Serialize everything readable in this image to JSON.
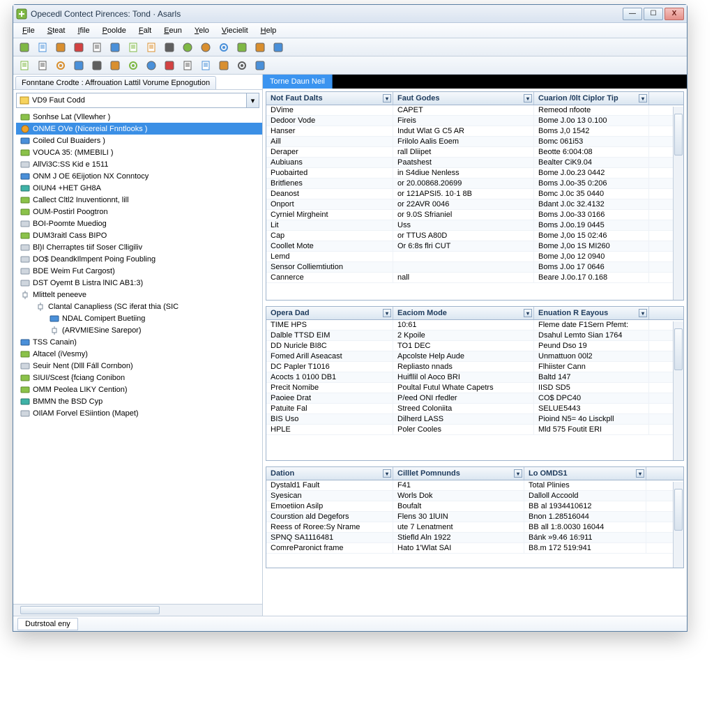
{
  "window": {
    "title": "Opecedl Contect Pirences: Tond · Asarls"
  },
  "menubar": [
    "File",
    "Steat",
    "Ifile",
    "Poolde",
    "Falt",
    "Eeun",
    "Yelo",
    "Viecielit",
    "Help"
  ],
  "lefttab": "Fonntane Crodte : Affrouation Lattil Vorume Epnogution",
  "combo": "VD9 Faut Codd",
  "tree": [
    {
      "label": "Sonhse Lat (Vllewher )",
      "ic": "green",
      "lv": 0
    },
    {
      "label": "ONME OVe (Nicereial Fnntlooks )",
      "ic": "orange",
      "lv": 0,
      "sel": true
    },
    {
      "label": "Coiled Cul Buaiders )",
      "ic": "blue",
      "lv": 0
    },
    {
      "label": "VOUCA 35: (MMEBILI )",
      "ic": "green",
      "lv": 0
    },
    {
      "label": "AllVi3C:SS Kid e 1511",
      "ic": "gray",
      "lv": 0
    },
    {
      "label": "ONM J OE 6Eijotion NX Conntocy",
      "ic": "blue",
      "lv": 0
    },
    {
      "label": "OIUN4 +HET GH8A",
      "ic": "teal",
      "lv": 0
    },
    {
      "label": "Callect Cltl2 Inuventionnt, lill",
      "ic": "green",
      "lv": 0
    },
    {
      "label": "OUM-Postirl Poogtron",
      "ic": "green",
      "lv": 0
    },
    {
      "label": "BOI-Poomte Muediog",
      "ic": "gray",
      "lv": 0
    },
    {
      "label": "DUM3raitl Cass BIPO",
      "ic": "green",
      "lv": 0
    },
    {
      "label": "Bl)I Cherraptes tiif Soser Clligiliv",
      "ic": "gray",
      "lv": 0
    },
    {
      "label": "DO$ DeandkIlmpent Poing Foubling",
      "ic": "gray",
      "lv": 0
    },
    {
      "label": "BDE Weim Fut Cargost)",
      "ic": "gray",
      "lv": 0
    },
    {
      "label": "DST Oyemt B Listra lNIC AB1:3)",
      "ic": "gray",
      "lv": 0
    },
    {
      "label": "Mlittelt peneeve",
      "ic": "node",
      "lv": 0
    },
    {
      "label": "Clantal Canapliess (SC iferat thia (SIC",
      "ic": "node",
      "lv": 1
    },
    {
      "label": "NDAL Comipert Buetiing",
      "ic": "blue",
      "lv": 2
    },
    {
      "label": "(ARVMIESine Sarepor)",
      "ic": "node",
      "lv": 2
    },
    {
      "label": "TSS Canain)",
      "ic": "blue",
      "lv": 0
    },
    {
      "label": "Altacel (iVesmy)",
      "ic": "green",
      "lv": 0
    },
    {
      "label": "Seuir Nent (Dlll Fáll Cornbon)",
      "ic": "gray",
      "lv": 0
    },
    {
      "label": "SIUI/Scest {fciang Conibon",
      "ic": "green",
      "lv": 0
    },
    {
      "label": "OMM Peolea LIKY Cention)",
      "ic": "green",
      "lv": 0
    },
    {
      "label": "BMMN the BSD Cyp",
      "ic": "teal",
      "lv": 0
    },
    {
      "label": "OIlAM Forvel ESiintion (Mapet)",
      "ic": "gray",
      "lv": 0
    }
  ],
  "blacktab": "Torne Daun Neil",
  "table1": {
    "headers": [
      "Not Faut Dalts",
      "Faut Godes",
      "Cuarion /0lt Ciplor Tip"
    ],
    "rows": [
      [
        "DVime",
        "CAPET",
        "Remeod nfoote"
      ],
      [
        "Dedoor Vode",
        "Fireis",
        "Bome J.0o 13 0.100"
      ],
      [
        "Hanser",
        "Indut Wlat G C5 AR",
        "Boms J,0 1542"
      ],
      [
        "Aill",
        "Frilolo Aalis Eoem",
        "Bomc 061i53"
      ],
      [
        "Deraper",
        "rall Dliipet",
        "Beotte 6:004:08"
      ],
      [
        "Aubiuans",
        "Paatshest",
        "Bealter CiK9.04"
      ],
      [
        "Puobairted",
        "in S4diue Nenless",
        "Bome J.0o.23 0442"
      ],
      [
        "Britfienes",
        "or 20.00868.20699",
        "Boms J.0o-35 0:206"
      ],
      [
        "Deanost",
        "or 121APSI5. 10·1 8B",
        "Bomc J.0c 35 0440"
      ],
      [
        "Onport",
        "or 22AVR 0046",
        "Bdant J.0c 32.4132"
      ],
      [
        "Cyrniel Mirgheint",
        "or 9.0S Sfrianiel",
        "Boms J.0o-33 0166"
      ],
      [
        "Lit",
        "Uss",
        "Boms J.0o.19 0445"
      ],
      [
        "Cap",
        "or TTUS A80D",
        "Bome J,0o 15 02:46"
      ],
      [
        "Coollet Mote",
        "Or 6:8s flri CUT",
        "Bome J,0o 1S MI260"
      ],
      [
        "Lemd",
        "",
        "Bome J,0o 12 0940"
      ],
      [
        "Sensor Colliemtiution",
        "",
        "Boms J.0o 17 0646"
      ],
      [
        "Cannerce",
        "nall",
        "Beare J.0o.17 0.168"
      ]
    ]
  },
  "table2": {
    "headers": [
      "Opera Dad",
      "Eaciom Mode",
      "Enuation R Eayous"
    ],
    "rows": [
      [
        "TIME HPS",
        "10:61",
        "Fleme date F1Sern Pfemt:"
      ],
      [
        "Dalble TTSD EIM",
        "2 Kpoile",
        "Dsahul Lemto Sian 1764"
      ],
      [
        "DD Nuricle BI8C",
        "TO1 DEC",
        "Peund Dso 19"
      ],
      [
        "Fomed Arill Aseacast",
        "Apcolste Help Aude",
        "Unmattuon 00l2"
      ],
      [
        "DC Papler T1016",
        "Repliasto nnads",
        "Flhiister Cann"
      ],
      [
        "Acocts 1 0100 DB1",
        "Huifllil ol Aoco BRI",
        "Baltd 147"
      ],
      [
        "Precit Nomibe",
        "Poultal Futul Whate Capetrs",
        "IISD SD5"
      ],
      [
        "Paoiee Drat",
        "P/eed ONI rfedler",
        "CO$ DPC40"
      ],
      [
        "Patuite Fal",
        "Streed Coloniita",
        "SELUE5443"
      ],
      [
        "BIS Uso",
        "Dilherd LASS",
        "Pioind N5= 4o Lisckpll"
      ],
      [
        "HPLE",
        "Poler Cooles",
        "Mld 575 Foutit ERI"
      ]
    ]
  },
  "table3": {
    "headers": [
      "Dation",
      "Cilllet Pomnunds",
      "Lo OMDS1"
    ],
    "rows": [
      [
        "Dystald1 Fault",
        "F41",
        "Total Plinies"
      ],
      [
        "Syesican",
        "Worls Dok",
        "Dalloll Accoold"
      ],
      [
        "Emoetiion Asilp",
        "Boufalt",
        "BB al 1934410612"
      ],
      [
        "Courstion ald Degefors",
        "Flens 30 1lUIN",
        "Bnon 1.28516044"
      ],
      [
        "Reess of Roree:Sy Nrame",
        "ute 7 Lenatment",
        "BB all 1:8.0030 16044"
      ],
      [
        "SPNQ SA1116481",
        "Stiefld Aln 1922",
        "Bánk »9.46 16:911"
      ],
      [
        "ComreParonict frame",
        "Hato 1'Wlat SAI",
        "B8.m 172 519:941"
      ]
    ]
  },
  "status": "Dutrstoal eny",
  "icons": {
    "min": "—",
    "max": "☐",
    "close": "X",
    "down": "▾"
  }
}
